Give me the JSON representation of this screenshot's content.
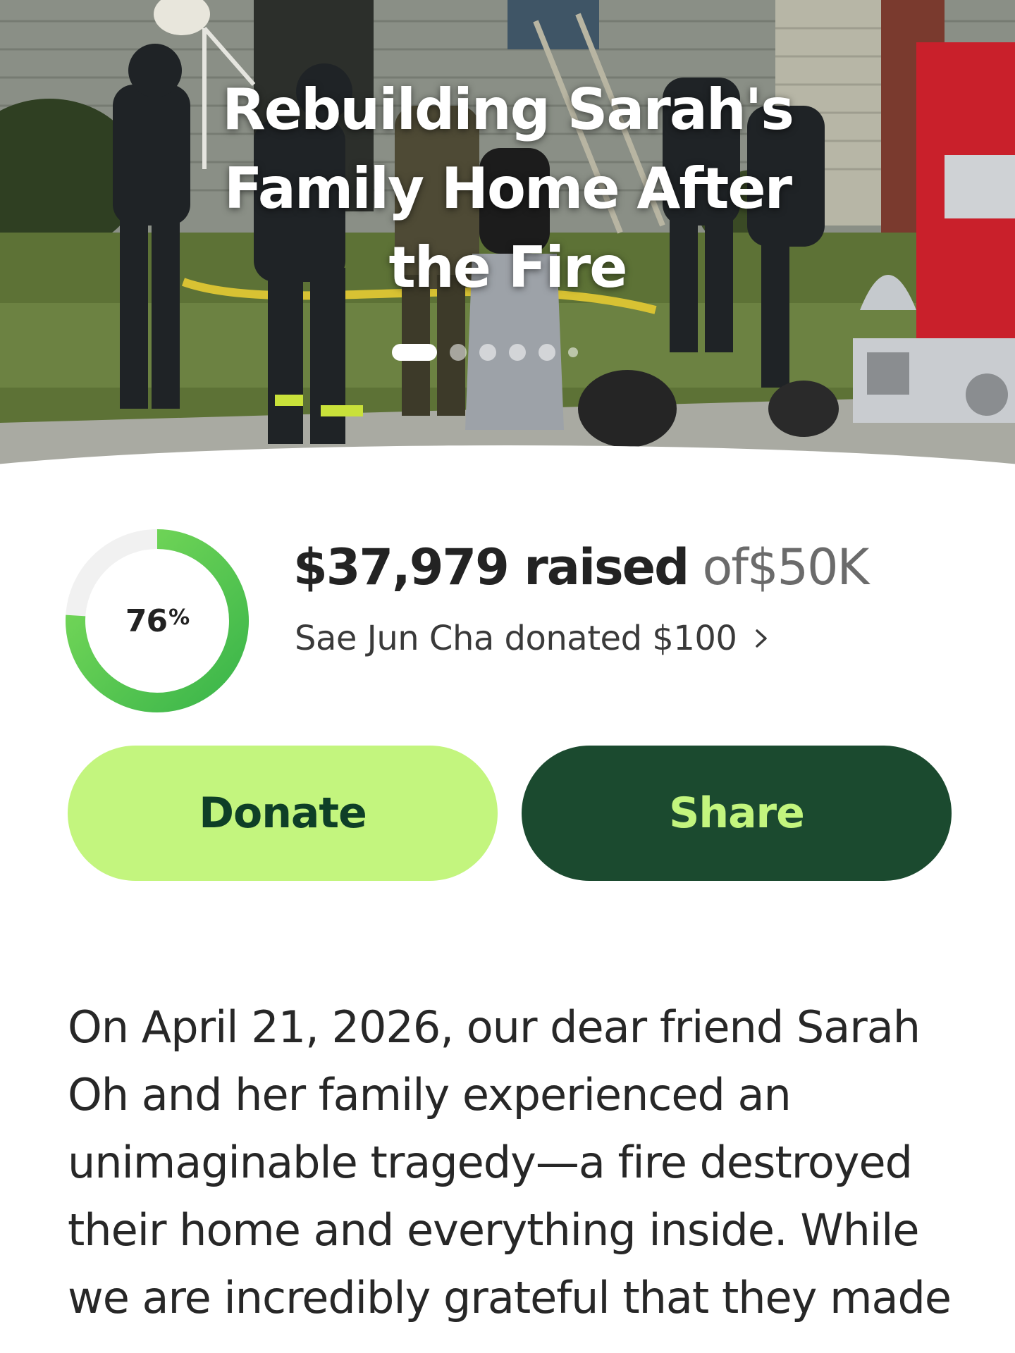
{
  "hero": {
    "title": "Rebuilding Sarah's Family Home After the Fire",
    "carousel": {
      "total_slides": 6,
      "active_index": 0
    }
  },
  "progress": {
    "percent": 76,
    "percent_label": "76",
    "percent_sign": "%",
    "raised_amount": "$37,979 raised",
    "of_word": "of",
    "goal": "$50K",
    "donor_text": "Sae Jun Cha donated $100",
    "colors": {
      "ring_track": "#f1f1f1",
      "ring_start": "#3ab54a",
      "ring_end": "#7ddc5a"
    }
  },
  "actions": {
    "donate_label": "Donate",
    "share_label": "Share",
    "colors": {
      "donate_bg": "#c3f57e",
      "donate_text": "#0e3f27",
      "share_bg": "#1b4a2f",
      "share_text": "#c3f57e"
    }
  },
  "story": {
    "text": "On April 21, 2026, our dear friend Sarah Oh and her family experienced an unimaginable tragedy—a fire destroyed their home and everything inside. While we are incredibly grateful that they made"
  }
}
